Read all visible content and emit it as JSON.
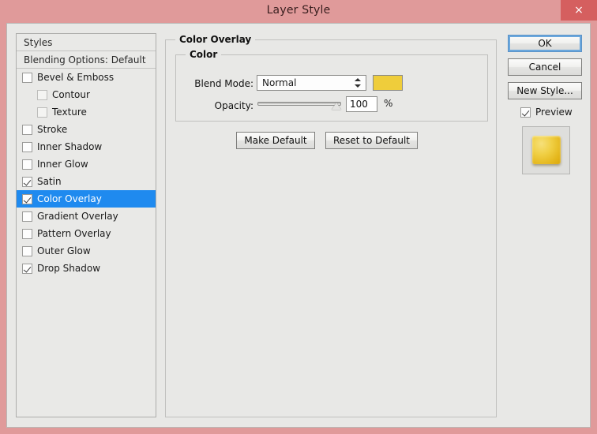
{
  "window": {
    "title": "Layer Style",
    "close_label": "×",
    "frame_color": "#e09a9a",
    "close_button_color": "#d55f5f"
  },
  "styles_panel": {
    "header": "Styles",
    "blending_options": "Blending Options: Default",
    "selection_color": "#1f8aef",
    "items": [
      {
        "label": "Bevel & Emboss",
        "checked": false,
        "indent": false,
        "selected": false,
        "disabled": false
      },
      {
        "label": "Contour",
        "checked": false,
        "indent": true,
        "selected": false,
        "disabled": true
      },
      {
        "label": "Texture",
        "checked": false,
        "indent": true,
        "selected": false,
        "disabled": true
      },
      {
        "label": "Stroke",
        "checked": false,
        "indent": false,
        "selected": false,
        "disabled": false
      },
      {
        "label": "Inner Shadow",
        "checked": false,
        "indent": false,
        "selected": false,
        "disabled": false
      },
      {
        "label": "Inner Glow",
        "checked": false,
        "indent": false,
        "selected": false,
        "disabled": false
      },
      {
        "label": "Satin",
        "checked": true,
        "indent": false,
        "selected": false,
        "disabled": false
      },
      {
        "label": "Color Overlay",
        "checked": true,
        "indent": false,
        "selected": true,
        "disabled": false
      },
      {
        "label": "Gradient Overlay",
        "checked": false,
        "indent": false,
        "selected": false,
        "disabled": false
      },
      {
        "label": "Pattern Overlay",
        "checked": false,
        "indent": false,
        "selected": false,
        "disabled": false
      },
      {
        "label": "Outer Glow",
        "checked": false,
        "indent": false,
        "selected": false,
        "disabled": false
      },
      {
        "label": "Drop Shadow",
        "checked": true,
        "indent": false,
        "selected": false,
        "disabled": false
      }
    ]
  },
  "main_panel": {
    "group_title": "Color Overlay",
    "color_group_title": "Color",
    "blend_mode_label": "Blend Mode:",
    "blend_mode_value": "Normal",
    "color_swatch_hex": "#efcd3b",
    "opacity_label": "Opacity:",
    "opacity_value": "100",
    "opacity_unit": "%",
    "opacity_percent": 100,
    "make_default_label": "Make Default",
    "reset_default_label": "Reset to Default"
  },
  "right_column": {
    "ok_label": "OK",
    "cancel_label": "Cancel",
    "new_style_label": "New Style...",
    "preview_label": "Preview",
    "preview_checked": true,
    "preview_swatch_hex": "#f0cf44"
  }
}
